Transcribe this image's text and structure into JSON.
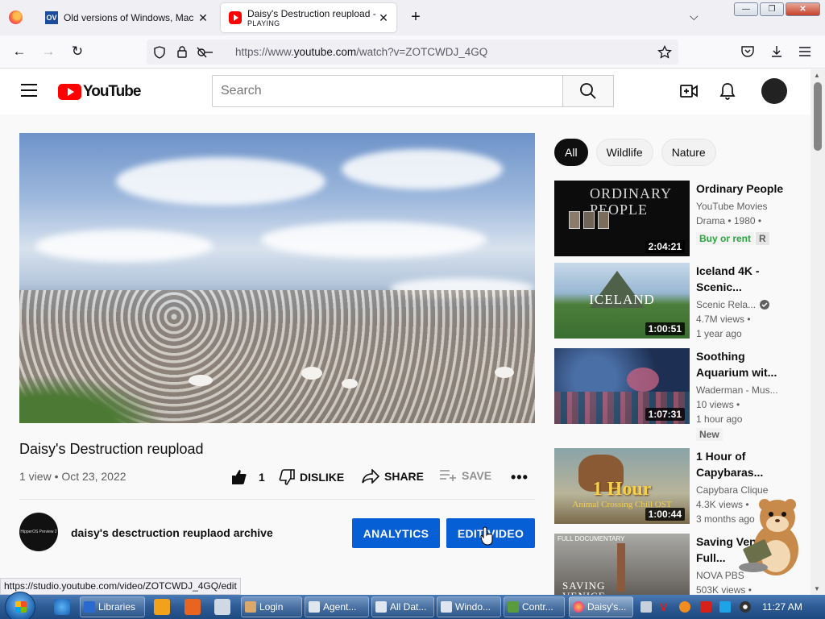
{
  "browser": {
    "tabs": [
      {
        "title": "Old versions of Windows, Mac and...",
        "favicon": "OV"
      },
      {
        "title": "Daisy's Destruction reupload - YouTube",
        "subtitle": "PLAYING"
      }
    ],
    "url_prefix": "https://www.",
    "url_domain": "youtube.com",
    "url_rest": "/watch?v=ZOTCWDJ_4GQ",
    "window_buttons": {
      "minimize": "—",
      "maximize": "❐",
      "close": "✕"
    }
  },
  "youtube": {
    "logo_text": "YouTube",
    "search_placeholder": "Search",
    "video": {
      "title": "Daisy's Destruction reupload",
      "meta": "1 view • Oct 23, 2022",
      "like_count": "1",
      "dislike_label": "DISLIKE",
      "share_label": "SHARE",
      "save_label": "SAVE",
      "more_label": "•••"
    },
    "channel": {
      "name": "daisy's desctruction reuplaod archive",
      "avatar_text": "HipperOS Preview 2",
      "analytics_label": "ANALYTICS",
      "edit_label": "EDIT VIDEO"
    },
    "chips": [
      "All",
      "Wildlife",
      "Nature"
    ],
    "recommendations": [
      {
        "title": "Ordinary People",
        "line1": "YouTube Movies",
        "line2": "Drama • 1980 •",
        "badge": "Buy or rent",
        "rating": "R",
        "duration": "2:04:21",
        "thumb_text": "ORDINARY PEOPLE"
      },
      {
        "title": "Iceland 4K - Scenic...",
        "line1": "Scenic Rela...",
        "line2": "4.7M views •",
        "line3": "1 year ago",
        "duration": "1:00:51",
        "thumb_text": "ICELAND",
        "verified": true
      },
      {
        "title": "Soothing Aquarium wit...",
        "line1": "Waderman - Mus...",
        "line2": "10 views •",
        "line3": "1 hour ago",
        "badge": "New",
        "duration": "1:07:31"
      },
      {
        "title": "1 Hour of Capybaras...",
        "line1": "Capybara Clique",
        "line2": "4.3K views •",
        "line3": "3 months ago",
        "duration": "1:00:44",
        "thumb_text": "1 Hour",
        "thumb_subtext": "Animal Crossing Chill OST"
      },
      {
        "title": "Saving Venice Full...",
        "line1": "NOVA PBS",
        "line2": "503K views •",
        "thumb_text": "SAVING VENICE",
        "thumb_corner": "FULL DOCUMENTARY"
      }
    ],
    "status_url": "https://studio.youtube.com/video/ZOTCWDJ_4GQ/edit"
  },
  "taskbar": {
    "buttons": [
      "Libraries",
      "Login",
      "Agent...",
      "All Dat...",
      "Windo...",
      "Contr...",
      "Daisy's..."
    ],
    "clock": "11:27 AM"
  }
}
